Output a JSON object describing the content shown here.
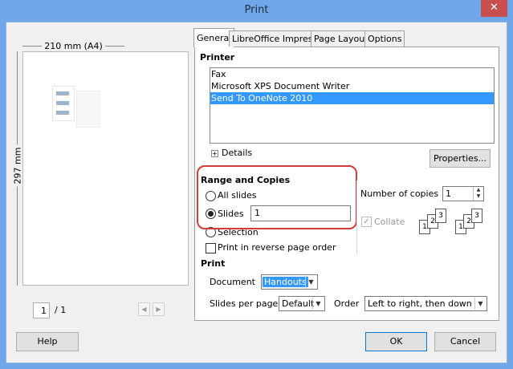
{
  "window": {
    "title": "Print",
    "close_glyph": "✕"
  },
  "preview": {
    "width_label": "210 mm (A4)",
    "height_label": "297 mm",
    "page_current": "1",
    "page_total": "/ 1",
    "prev_glyph": "◀",
    "next_glyph": "▶"
  },
  "tabs": [
    {
      "label": "General",
      "active": true
    },
    {
      "label": "LibreOffice Impress",
      "active": false
    },
    {
      "label": "Page Layout",
      "active": false
    },
    {
      "label": "Options",
      "active": false
    }
  ],
  "printer": {
    "heading": "Printer",
    "items": [
      "Fax",
      "Microsoft XPS Document Writer",
      "Send To OneNote 2010"
    ],
    "selected_index": 2,
    "details_label": "Details",
    "expand_glyph": "+",
    "properties_label": "Properties..."
  },
  "range": {
    "heading": "Range and Copies",
    "all_slides_label": "All slides",
    "slides_label": "Slides",
    "slides_value": "1",
    "selection_label": "Selection",
    "reverse_label": "Print in reverse page order",
    "copies_label": "Number of copies",
    "copies_value": "1",
    "collate_label": "Collate",
    "collate_check_glyph": "✓"
  },
  "print_section": {
    "heading": "Print",
    "document_label": "Document",
    "document_value": "Handouts",
    "slides_per_page_label": "Slides per page",
    "slides_per_page_value": "Default",
    "order_label": "Order",
    "order_value": "Left to right, then down"
  },
  "buttons": {
    "help": "Help",
    "ok": "OK",
    "cancel": "Cancel"
  },
  "colors": {
    "titlebar": "#6fa7e8",
    "selection": "#3399ff",
    "highlight_ring": "#d73a3a",
    "close": "#c7504f"
  }
}
